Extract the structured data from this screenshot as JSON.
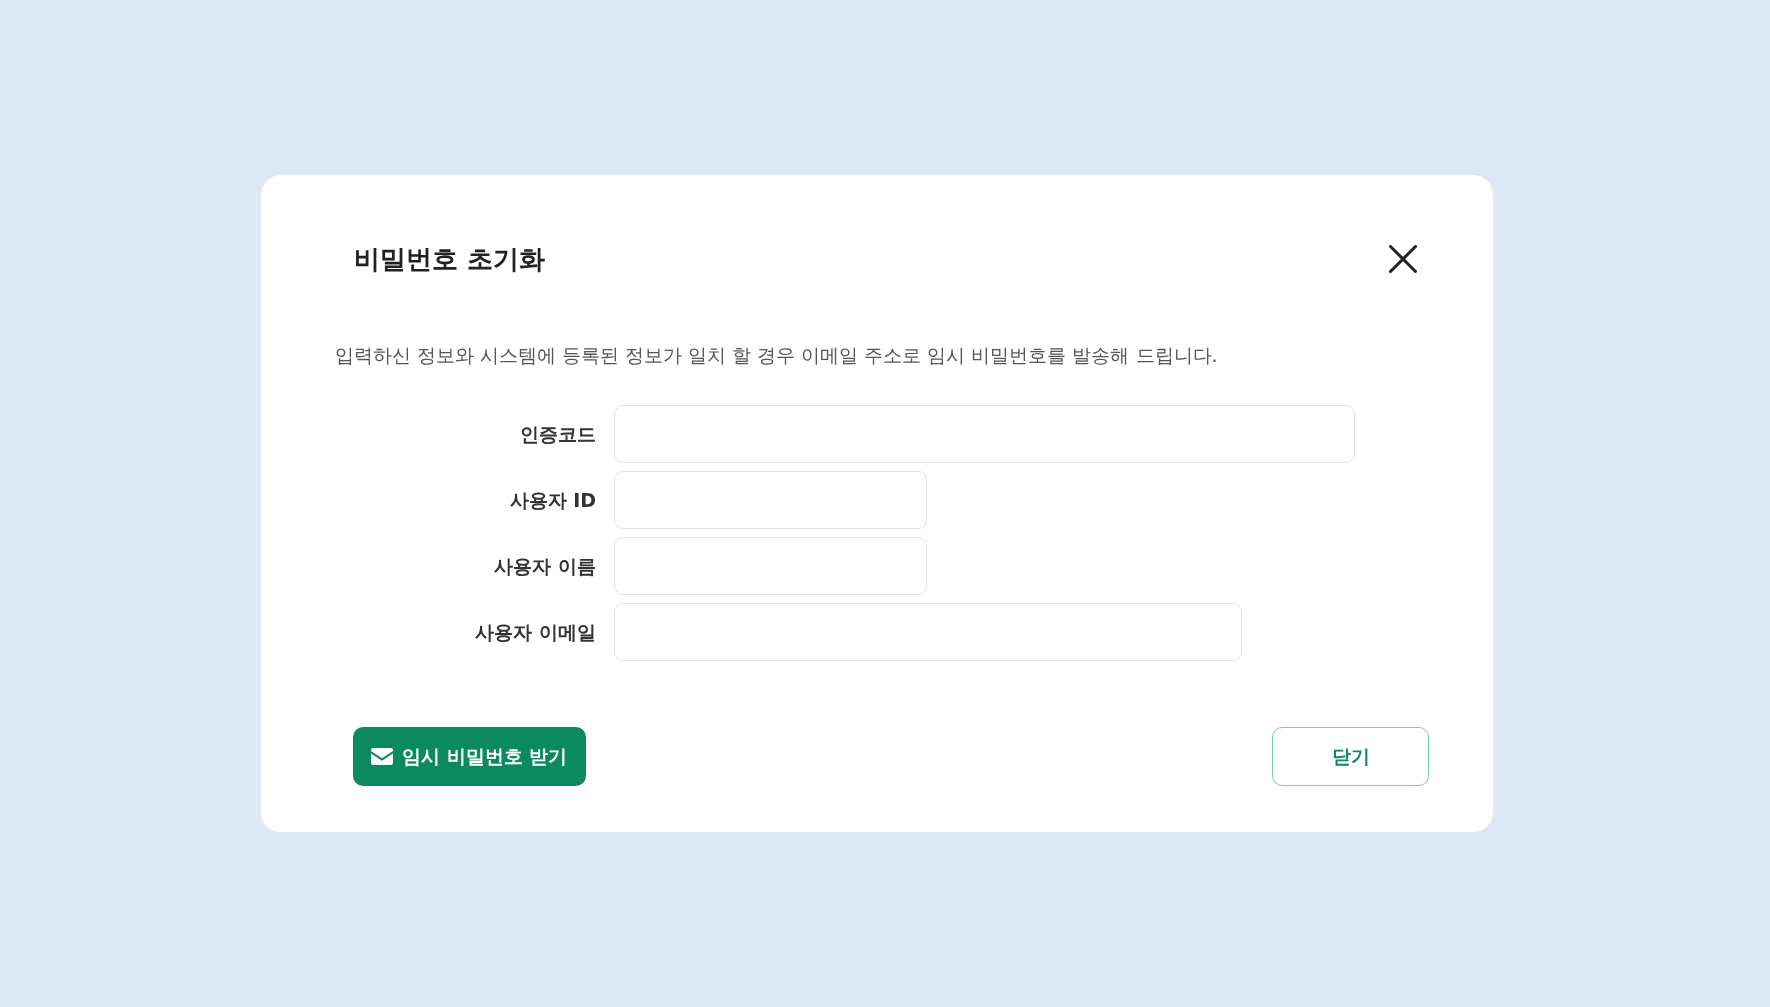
{
  "dialog": {
    "title": "비밀번호 초기화",
    "description": "입력하신 정보와 시스템에 등록된 정보가 일치 할 경우 이메일 주소로 임시 비밀번호를 발송해 드립니다.",
    "fields": [
      {
        "label": "인증코드"
      },
      {
        "label": "사용자 ID"
      },
      {
        "label": "사용자 이름"
      },
      {
        "label": "사용자 이메일"
      }
    ],
    "buttons": [
      {
        "label": "임시 비밀번호 받기",
        "kind": "primary"
      },
      {
        "label": "닫기",
        "kind": "secondary"
      }
    ]
  }
}
